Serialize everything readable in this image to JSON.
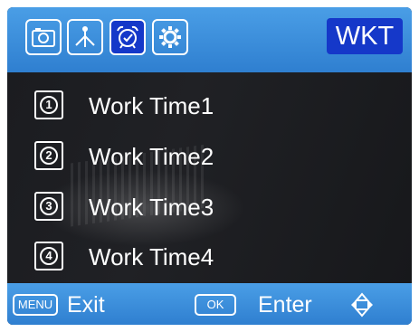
{
  "topbar": {
    "tabs": [
      {
        "name": "camera-icon",
        "active": false
      },
      {
        "name": "antenna-icon",
        "active": false
      },
      {
        "name": "alarm-clock-icon",
        "active": true
      },
      {
        "name": "gear-icon",
        "active": false
      }
    ],
    "mode_badge": "WKT",
    "colors": {
      "bar": "#3f8fdc",
      "active": "#1538c9"
    }
  },
  "menu": {
    "items": [
      {
        "number": "1",
        "label": "Work Time1"
      },
      {
        "number": "2",
        "label": "Work Time2"
      },
      {
        "number": "3",
        "label": "Work Time3"
      },
      {
        "number": "4",
        "label": "Work Time4"
      }
    ]
  },
  "bottombar": {
    "menu_key": "MENU",
    "exit_label": "Exit",
    "ok_key": "OK",
    "enter_label": "Enter",
    "nav_icon": "navigation-arrows-icon"
  }
}
